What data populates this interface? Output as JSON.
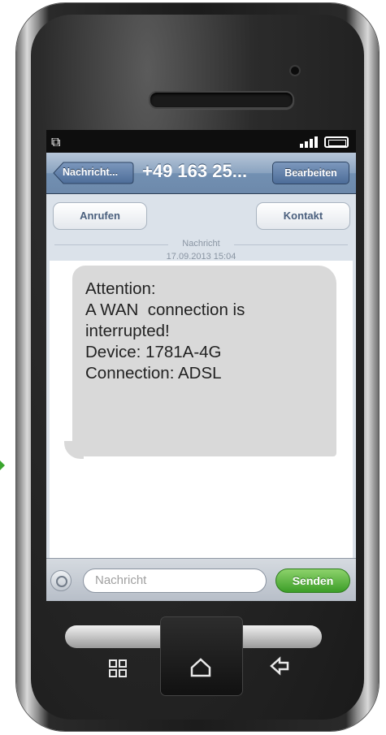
{
  "status_bar": {
    "left_icon": "screen-rotate-icon",
    "signal_icon": "signal-bars-icon",
    "battery_icon": "battery-icon"
  },
  "nav": {
    "back_label": "Nachricht...",
    "title": "+49 163 25...",
    "edit_label": "Bearbeiten"
  },
  "actions": {
    "call_label": "Anrufen",
    "contact_label": "Kontakt"
  },
  "thread": {
    "separator_label": "Nachricht",
    "timestamp": "17.09.2013 15:04"
  },
  "message": {
    "lines": [
      "Attention:",
      "A WAN  connection is",
      "interrupted!",
      "Device: 1781A-4G",
      "Connection: ADSL"
    ]
  },
  "input_bar": {
    "placeholder": "Nachricht",
    "send_label": "Senden"
  },
  "hardware": {
    "menu_icon": "menu-grid-icon",
    "home_icon": "home-icon",
    "back_icon": "back-arrow-icon"
  },
  "colors": {
    "send_green": "#3c9e28",
    "nav_blue": "#7290b2",
    "bubble_gray": "#d9d9d9"
  }
}
